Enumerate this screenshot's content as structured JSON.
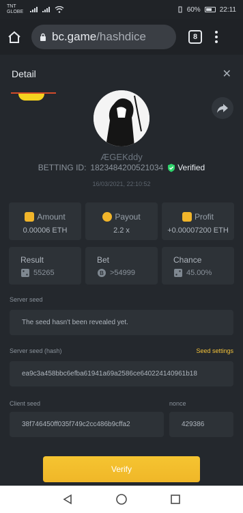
{
  "status": {
    "carrier_1": "TNT",
    "carrier_2": "GLOBE",
    "battery": "60%",
    "time": "22:11"
  },
  "browser": {
    "url_host": "bc.game",
    "url_path": "/hashdice",
    "tab_count": "8"
  },
  "modal": {
    "title": "Detail"
  },
  "user": {
    "name": "ÆGEKddy",
    "betting_id_label": "BETTING ID:",
    "betting_id": "1823484200521034",
    "verified": "Verified",
    "datetime": "16/03/2021, 22:10:52"
  },
  "stats": {
    "amount_label": "Amount",
    "amount_value": "0.00006 ETH",
    "payout_label": "Payout",
    "payout_value": "2.2 x",
    "profit_label": "Profit",
    "profit_value": "+0.00007200 ETH",
    "result_label": "Result",
    "result_value": "55265",
    "bet_label": "Bet",
    "bet_value": ">54999",
    "chance_label": "Chance",
    "chance_value": "45.00%"
  },
  "seeds": {
    "server_seed_label": "Server seed",
    "server_seed_value": "The seed hasn't been revealed yet.",
    "server_hash_label": "Server seed (hash)",
    "seed_settings": "Seed settings",
    "server_hash_value": "ea9c3a458bbc6efba61941a69a2586ce640224140961b18",
    "client_seed_label": "Client seed",
    "client_seed_value": "38f746450ff035f749c2cc486b9cffa2",
    "nonce_label": "nonce",
    "nonce_value": "429386"
  },
  "actions": {
    "verify": "Verify"
  },
  "colors": {
    "accent": "#f3c23a",
    "verified_green": "#2fd36b",
    "background": "#24282d"
  }
}
